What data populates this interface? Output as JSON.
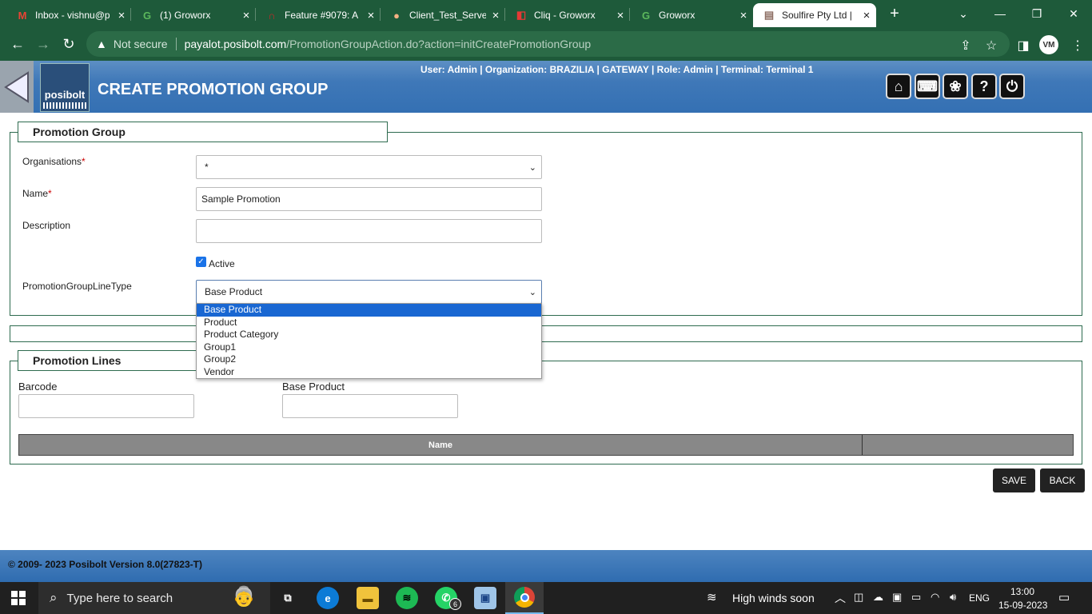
{
  "browser": {
    "tabs": [
      {
        "title": "Inbox - vishnu@p",
        "icon": "gmail-icon",
        "glyph": "M",
        "color": "#ea4335"
      },
      {
        "title": "(1) Groworx",
        "icon": "groworx-icon",
        "glyph": "G",
        "color": "#5cb85c"
      },
      {
        "title": "Feature #9079: A",
        "icon": "redmine-icon",
        "glyph": "∩",
        "color": "#c62828"
      },
      {
        "title": "Client_Test_Serve",
        "icon": "avatar-icon",
        "glyph": "●",
        "color": "#f4b183"
      },
      {
        "title": "Cliq - Groworx",
        "icon": "cliq-icon",
        "glyph": "◧",
        "color": "#e53935"
      },
      {
        "title": "Groworx",
        "icon": "groworx-icon",
        "glyph": "G",
        "color": "#5cb85c"
      },
      {
        "title": "Soulfire Pty Ltd |",
        "icon": "soulfire-icon",
        "glyph": "▤",
        "color": "#8d6e63"
      }
    ],
    "new_tab": "+",
    "not_secure": "Not secure",
    "url_domain": "payalot.posibolt.com",
    "url_path": "/PromotionGroupAction.do?action=initCreatePromotionGroup",
    "profile_initials": "VM"
  },
  "app": {
    "logo_text": "posibolt",
    "page_title": "CREATE PROMOTION GROUP",
    "user_info": "User: Admin | Organization: BRAZILIA | GATEWAY | Role: Admin | Terminal: Terminal 1",
    "header_buttons": [
      {
        "name": "home-icon",
        "glyph": "⌂"
      },
      {
        "name": "keyboard-icon",
        "glyph": "⌨"
      },
      {
        "name": "lotus-icon",
        "glyph": "❀"
      },
      {
        "name": "help-icon",
        "glyph": "?"
      },
      {
        "name": "power-icon",
        "glyph": "⏻"
      }
    ]
  },
  "promotion_group": {
    "legend": "Promotion Group",
    "organisations_label": "Organisations",
    "organisations_value": "*",
    "name_label": "Name",
    "name_value": "Sample Promotion",
    "description_label": "Description",
    "description_value": "",
    "active_label": "Active",
    "active_checked": true,
    "line_type_label": "PromotionGroupLineType",
    "line_type_value": "Base Product",
    "line_type_options": [
      "Base Product",
      "Product",
      "Product Category",
      "Group1",
      "Group2",
      "Vendor"
    ],
    "required_mark": "*"
  },
  "promotion_lines": {
    "legend": "Promotion Lines",
    "barcode_label": "Barcode",
    "base_product_label": "Base Product",
    "column_name": "Name"
  },
  "actions": {
    "save": "SAVE",
    "back": "BACK"
  },
  "footer": {
    "text": "© 2009- 2023 Posibolt Version  8.0(27823-T)"
  },
  "taskbar": {
    "search_placeholder": "Type here to search",
    "whatsapp_badge": "6",
    "weather": "High winds soon",
    "language": "ENG",
    "time": "13:00",
    "date": "15-09-2023"
  }
}
